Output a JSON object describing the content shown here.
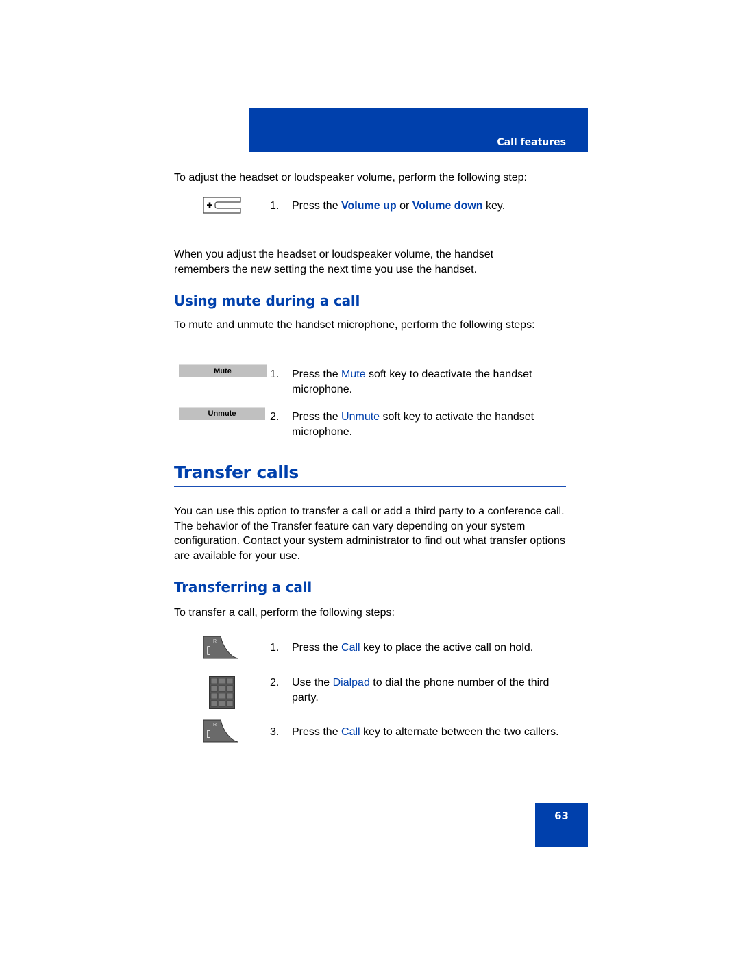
{
  "header": {
    "section_label": "Call features",
    "brand_color": "#0040ac"
  },
  "volume": {
    "intro": "To adjust the headset or loudspeaker volume, perform the following step:",
    "icon": "volume-key-icon",
    "steps": [
      {
        "num": "1.",
        "pre": "Press the ",
        "hl1": "Volume up",
        "mid": " or ",
        "hl2": "Volume down",
        "post": " key."
      }
    ],
    "note": "When you adjust the headset or loudspeaker volume, the handset remembers the new setting the next time you use the handset."
  },
  "mute": {
    "heading": "Using mute during a call",
    "intro": "To mute and unmute the handset microphone, perform the following steps:",
    "steps": [
      {
        "num": "1.",
        "softkey": "Mute",
        "pre": "Press the ",
        "hl": "Mute",
        "post": " soft key to deactivate the handset microphone."
      },
      {
        "num": "2.",
        "softkey": "Unmute",
        "pre": "Press the ",
        "hl": "Unmute",
        "post": " soft key to activate the handset microphone."
      }
    ]
  },
  "transfer": {
    "heading": "Transfer calls",
    "intro": "You can use this option to transfer a call or add a third party to a conference call. The behavior of the Transfer feature can vary depending on your system configuration. Contact your system administrator to find out what transfer options are available for your use."
  },
  "transferring": {
    "heading": "Transferring a call",
    "intro": "To transfer a call, perform the following steps:",
    "steps": [
      {
        "num": "1.",
        "icon": "call-key-icon",
        "pre": "Press the ",
        "hl": "Call",
        "post": " key to place the active call on hold."
      },
      {
        "num": "2.",
        "icon": "dialpad-icon",
        "pre": "Use the ",
        "hl": "Dialpad",
        "post": " to dial the phone number of the third party."
      },
      {
        "num": "3.",
        "icon": "call-key-icon",
        "pre": "Press the ",
        "hl": "Call",
        "post": " key to alternate between the two callers."
      }
    ]
  },
  "footer": {
    "page_number": "63"
  }
}
